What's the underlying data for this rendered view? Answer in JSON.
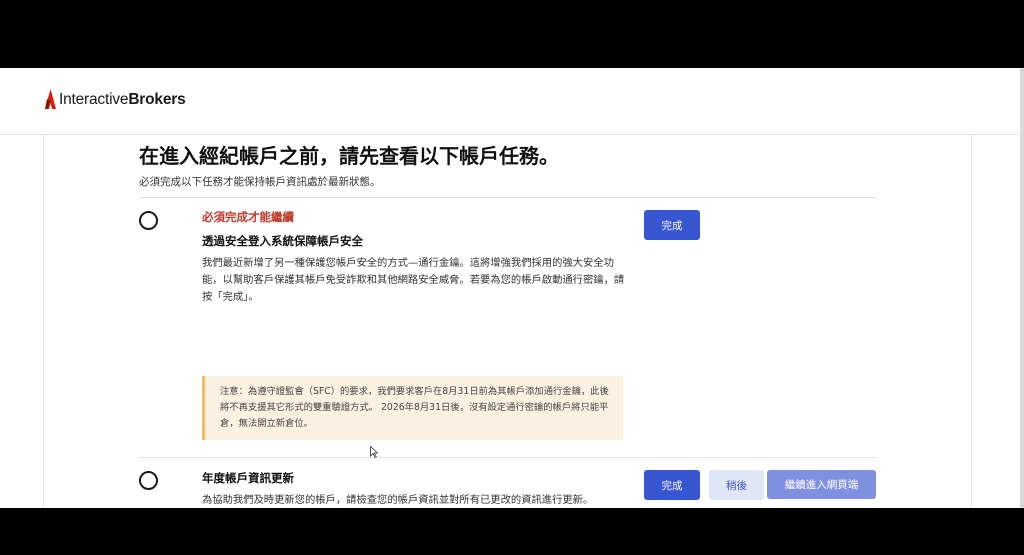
{
  "brand": {
    "name_light": "Interactive",
    "name_bold": "Brokers",
    "accent": "#d81e05"
  },
  "page": {
    "title": "在進入經紀帳戶之前，請先查看以下帳戶任務。",
    "subtitle": "必須完成以下任務才能保持帳戶資訊處於最新狀態。"
  },
  "tasks": [
    {
      "required_label": "必須完成才能繼續",
      "title": "透過安全登入系統保障帳戶安全",
      "description": "我們最近新增了另一種保護您帳戶安全的方式—通行金鑰。這將增強我們採用的強大安全功能，以幫助客戶保護其帳戶免受詐欺和其他網路安全威脅。若要為您的帳戶啟動通行密鑰，請按「完成」。",
      "notice": "注意：為遵守證監會（SFC）的要求，我們要求客戶在8月31日前為其帳戶添加通行金鑰，此後將不再支援其它形式的雙重驗證方式。 2026年8月31日後，沒有設定通行密鑰的帳戶將只能平倉，無法開立新倉位。",
      "complete_label": "完成"
    },
    {
      "title": "年度帳戶資訊更新",
      "description": "為協助我們及時更新您的帳戶，請檢查您的帳戶資訊並對所有已更改的資訊進行更新。",
      "complete_label": "完成",
      "later_label": "稍後"
    }
  ],
  "footer": {
    "continue_label": "繼續進入網頁端"
  },
  "colors": {
    "primary": "#3756d1",
    "primary_disabled": "#8090e0",
    "secondary_bg": "#dee6f8",
    "required_text": "#c0392b",
    "notice_bg": "#fbf1e1",
    "notice_border": "#f0c060"
  }
}
